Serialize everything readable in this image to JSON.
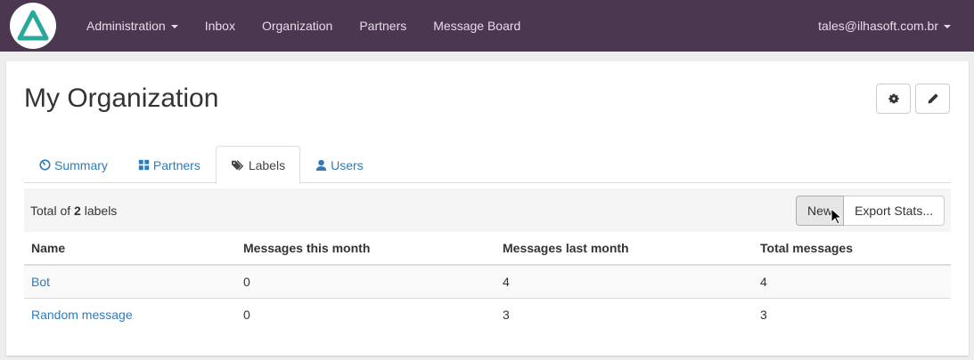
{
  "navbar": {
    "items": [
      {
        "label": "Administration",
        "has_caret": true
      },
      {
        "label": "Inbox"
      },
      {
        "label": "Organization"
      },
      {
        "label": "Partners"
      },
      {
        "label": "Message Board"
      }
    ],
    "user": "tales@ilhasoft.com.br",
    "background": "#4c3750"
  },
  "page": {
    "title": "My Organization",
    "settings_icon": "gear-icon",
    "edit_icon": "pencil-icon"
  },
  "tabs": [
    {
      "label": "Summary",
      "icon": "dashboard-icon"
    },
    {
      "label": "Partners",
      "icon": "grid-icon"
    },
    {
      "label": "Labels",
      "icon": "tags-icon",
      "active": true
    },
    {
      "label": "Users",
      "icon": "user-icon"
    }
  ],
  "toolbar": {
    "total_prefix": "Total of",
    "total_count": "2",
    "total_suffix": "labels",
    "new_label": "New",
    "export_label": "Export Stats..."
  },
  "table": {
    "headers": [
      "Name",
      "Messages this month",
      "Messages last month",
      "Total messages"
    ],
    "rows": [
      [
        "Bot",
        "0",
        "4",
        "4"
      ],
      [
        "Random message",
        "0",
        "3",
        "3"
      ]
    ]
  },
  "colors": {
    "link": "#337ab7",
    "navbar": "#4c3750"
  }
}
